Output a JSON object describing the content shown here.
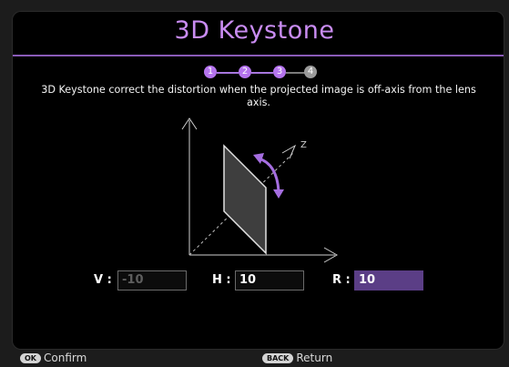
{
  "title": "3D Keystone",
  "steps": [
    "1",
    "2",
    "3",
    "4"
  ],
  "description": "3D Keystone correct the distortion when the projected image is off-axis from the lens axis.",
  "diagram": {
    "axis_label": "Z"
  },
  "fields": {
    "v": {
      "label": "V",
      "value": "-10"
    },
    "h": {
      "label": "H",
      "value": "10"
    },
    "r": {
      "label": "R",
      "value": "10"
    }
  },
  "footer": {
    "ok_key": "OK",
    "confirm_label": "Confirm",
    "back_key": "BACK",
    "return_label": "Return"
  },
  "colors": {
    "accent": "#b574ee",
    "title": "#c98cf2",
    "active_field": "#5b3e86"
  },
  "icons": {
    "rotate_arrow": "curved-double-arrow-icon",
    "screen": "tilted-screen-icon"
  }
}
